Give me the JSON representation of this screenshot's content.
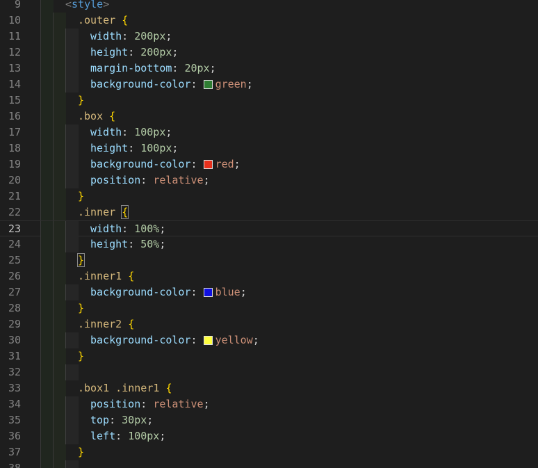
{
  "editor": {
    "language": "css",
    "current_line": 23,
    "lines": [
      {
        "n": "9",
        "indent": 3,
        "tokens": [
          [
            "tag",
            "<"
          ],
          [
            "tagname",
            "style"
          ],
          [
            "tag",
            ">"
          ]
        ]
      },
      {
        "n": "10",
        "indent": 4,
        "tokens": [
          [
            "sel",
            ".outer "
          ],
          [
            "brace",
            "{"
          ]
        ]
      },
      {
        "n": "11",
        "indent": 5,
        "tokens": [
          [
            "prop",
            "width"
          ],
          [
            "punc",
            ": "
          ],
          [
            "num",
            "200px"
          ],
          [
            "punc",
            ";"
          ]
        ]
      },
      {
        "n": "12",
        "indent": 5,
        "tokens": [
          [
            "prop",
            "height"
          ],
          [
            "punc",
            ": "
          ],
          [
            "num",
            "200px"
          ],
          [
            "punc",
            ";"
          ]
        ]
      },
      {
        "n": "13",
        "indent": 5,
        "tokens": [
          [
            "prop",
            "margin-bottom"
          ],
          [
            "punc",
            ": "
          ],
          [
            "num",
            "20px"
          ],
          [
            "punc",
            ";"
          ]
        ]
      },
      {
        "n": "14",
        "indent": 5,
        "tokens": [
          [
            "prop",
            "background-color"
          ],
          [
            "punc",
            ": "
          ],
          [
            "swatch",
            "#2e7d32"
          ],
          [
            "val",
            "green"
          ],
          [
            "punc",
            ";"
          ]
        ]
      },
      {
        "n": "15",
        "indent": 4,
        "tokens": [
          [
            "brace",
            "}"
          ]
        ]
      },
      {
        "n": "16",
        "indent": 4,
        "tokens": [
          [
            "sel",
            ".box "
          ],
          [
            "brace",
            "{"
          ]
        ]
      },
      {
        "n": "17",
        "indent": 5,
        "tokens": [
          [
            "prop",
            "width"
          ],
          [
            "punc",
            ": "
          ],
          [
            "num",
            "100px"
          ],
          [
            "punc",
            ";"
          ]
        ]
      },
      {
        "n": "18",
        "indent": 5,
        "tokens": [
          [
            "prop",
            "height"
          ],
          [
            "punc",
            ": "
          ],
          [
            "num",
            "100px"
          ],
          [
            "punc",
            ";"
          ]
        ]
      },
      {
        "n": "19",
        "indent": 5,
        "tokens": [
          [
            "prop",
            "background-color"
          ],
          [
            "punc",
            ": "
          ],
          [
            "swatch",
            "#e8301c"
          ],
          [
            "val",
            "red"
          ],
          [
            "punc",
            ";"
          ]
        ]
      },
      {
        "n": "20",
        "indent": 5,
        "tokens": [
          [
            "prop",
            "position"
          ],
          [
            "punc",
            ": "
          ],
          [
            "val",
            "relative"
          ],
          [
            "punc",
            ";"
          ]
        ]
      },
      {
        "n": "21",
        "indent": 4,
        "tokens": [
          [
            "brace",
            "}"
          ]
        ]
      },
      {
        "n": "22",
        "indent": 4,
        "tokens": [
          [
            "sel",
            ".inner "
          ],
          [
            "brace match",
            "{"
          ]
        ]
      },
      {
        "n": "23",
        "indent": 5,
        "tokens": [
          [
            "prop",
            "width"
          ],
          [
            "punc",
            ": "
          ],
          [
            "num",
            "100%"
          ],
          [
            "punc",
            ";"
          ]
        ]
      },
      {
        "n": "24",
        "indent": 5,
        "tokens": [
          [
            "prop",
            "height"
          ],
          [
            "punc",
            ": "
          ],
          [
            "num",
            "50%"
          ],
          [
            "punc",
            ";"
          ]
        ]
      },
      {
        "n": "25",
        "indent": 4,
        "tokens": [
          [
            "brace match",
            "}"
          ]
        ]
      },
      {
        "n": "26",
        "indent": 4,
        "tokens": [
          [
            "sel",
            ".inner1 "
          ],
          [
            "brace",
            "{"
          ]
        ]
      },
      {
        "n": "27",
        "indent": 5,
        "tokens": [
          [
            "prop",
            "background-color"
          ],
          [
            "punc",
            ": "
          ],
          [
            "swatch",
            "#1010e0"
          ],
          [
            "val",
            "blue"
          ],
          [
            "punc",
            ";"
          ]
        ]
      },
      {
        "n": "28",
        "indent": 4,
        "tokens": [
          [
            "brace",
            "}"
          ]
        ]
      },
      {
        "n": "29",
        "indent": 4,
        "tokens": [
          [
            "sel",
            ".inner2 "
          ],
          [
            "brace",
            "{"
          ]
        ]
      },
      {
        "n": "30",
        "indent": 5,
        "tokens": [
          [
            "prop",
            "background-color"
          ],
          [
            "punc",
            ": "
          ],
          [
            "swatch",
            "#ffff40"
          ],
          [
            "val",
            "yellow"
          ],
          [
            "punc",
            ";"
          ]
        ]
      },
      {
        "n": "31",
        "indent": 4,
        "tokens": [
          [
            "brace",
            "}"
          ]
        ]
      },
      {
        "n": "32",
        "indent": 3,
        "tokens": []
      },
      {
        "n": "33",
        "indent": 4,
        "tokens": [
          [
            "sel",
            ".box1 .inner1 "
          ],
          [
            "brace",
            "{"
          ]
        ]
      },
      {
        "n": "34",
        "indent": 5,
        "tokens": [
          [
            "prop",
            "position"
          ],
          [
            "punc",
            ": "
          ],
          [
            "val",
            "relative"
          ],
          [
            "punc",
            ";"
          ]
        ]
      },
      {
        "n": "35",
        "indent": 5,
        "tokens": [
          [
            "prop",
            "top"
          ],
          [
            "punc",
            ": "
          ],
          [
            "num",
            "30px"
          ],
          [
            "punc",
            ";"
          ]
        ]
      },
      {
        "n": "36",
        "indent": 5,
        "tokens": [
          [
            "prop",
            "left"
          ],
          [
            "punc",
            ": "
          ],
          [
            "num",
            "100px"
          ],
          [
            "punc",
            ";"
          ]
        ]
      },
      {
        "n": "37",
        "indent": 4,
        "tokens": [
          [
            "brace",
            "}"
          ]
        ]
      },
      {
        "n": "38",
        "indent": 3,
        "tokens": []
      }
    ]
  }
}
